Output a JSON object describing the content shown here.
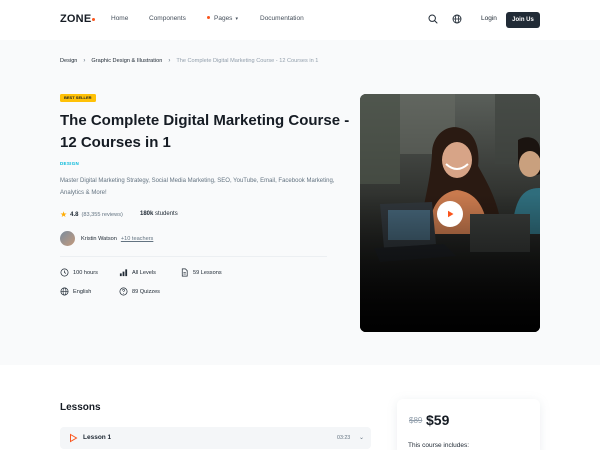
{
  "nav": {
    "logo": "ZONE",
    "links": [
      "Home",
      "Components",
      "Pages",
      "Documentation"
    ],
    "login": "Login",
    "join": "Join Us"
  },
  "breadcrumb": [
    "Design",
    "Graphic Design & Illustration",
    "The Complete Digital Marketing Course - 12 Courses in 1"
  ],
  "course": {
    "badge": "BEST SELLER",
    "title": "The Complete Digital Marketing Course - 12 Courses in 1",
    "category": "DESIGN",
    "description": "Master Digital Marketing Strategy, Social Media Marketing, SEO, YouTube, Email, Facebook Marketing, Analytics & More!",
    "rating": "4.8",
    "reviews": "(83,355 reviews)",
    "students_value": "180k",
    "students_label": "students",
    "teacher": "Kristin Watson",
    "more_teachers": "+10 teachers",
    "stats": {
      "hours": "100 hours",
      "level": "All Levels",
      "lessons": "59 Lessons",
      "language": "English",
      "quizzes": "89 Quizzes"
    }
  },
  "icons": {
    "search": "search-icon",
    "language": "globe-icon",
    "play": "play-icon"
  },
  "colors": {
    "accent": "#fa541c",
    "badge": "#ffc107",
    "category": "#00b8d9",
    "dark": "#212b36"
  },
  "lessons": {
    "title": "Lessons",
    "items": [
      {
        "name": "Lesson 1",
        "duration": "03:23"
      }
    ]
  },
  "pricing": {
    "old_price": "$89",
    "price": "$59",
    "includes": "This course includes:"
  }
}
